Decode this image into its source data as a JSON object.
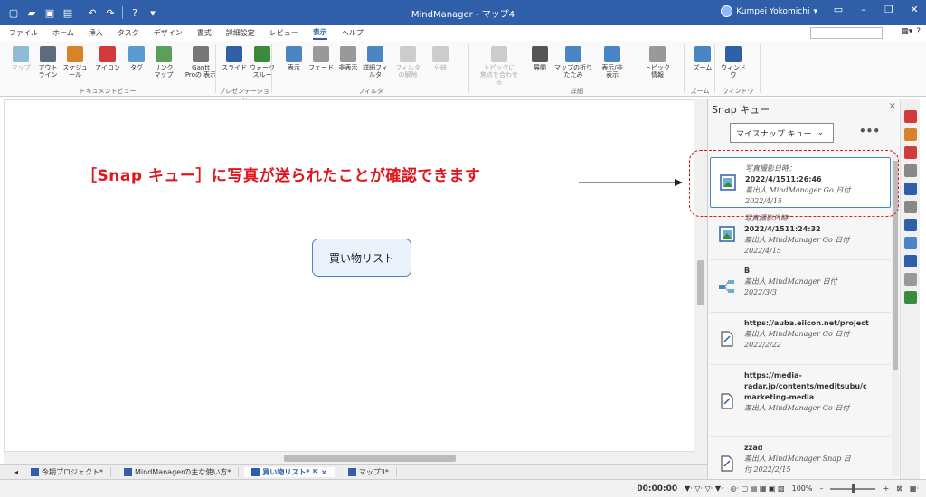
{
  "window": {
    "title": "MindManager - マップ4",
    "user": "Kumpei Yokomichi"
  },
  "tabs": [
    "ファイル",
    "ホーム",
    "挿入",
    "タスク",
    "デザイン",
    "書式",
    "詳細設定",
    "レビュー",
    "表示",
    "ヘルプ"
  ],
  "active_tab_index": 8,
  "ribbon": {
    "buttons": [
      {
        "label": "マップ",
        "color": "#8fbbd9"
      },
      {
        "label": "アウト\nライン",
        "color": "#5a6d7e"
      },
      {
        "label": "スケジュール",
        "color": "#d9822b"
      },
      {
        "label": "アイコン",
        "color": "#d23b3b"
      },
      {
        "label": "タグ",
        "color": "#5a9bd4"
      },
      {
        "label": "リンク\nマップ",
        "color": "#5aa05a"
      },
      {
        "label": "Gantt\nProの 表示",
        "color": "#777777"
      },
      {
        "label": "スライド",
        "color": "#2f5fa8"
      },
      {
        "label": "ウォーク\nスルー",
        "color": "#3c8a3c"
      },
      {
        "label": "表示",
        "color": "#4a86c5"
      },
      {
        "label": "フェード",
        "color": "#999999"
      },
      {
        "label": "非表示",
        "color": "#999999"
      },
      {
        "label": "詳細フィルタ",
        "color": "#4a86c5"
      },
      {
        "label": "フィルタの解除",
        "color": "#cccccc"
      },
      {
        "label": "分岐",
        "color": "#cccccc"
      },
      {
        "label": "トピックに\n焦点を合わせる",
        "color": "#cccccc"
      },
      {
        "label": "展開",
        "color": "#555555"
      },
      {
        "label": "マップの折りたたみ",
        "color": "#4a86c5"
      },
      {
        "label": "表示/非表示",
        "color": "#4a86c5"
      },
      {
        "label": "トピック情報",
        "color": "#999999"
      },
      {
        "label": "ズーム",
        "color": "#4a86c5"
      },
      {
        "label": "ウィンドウ",
        "color": "#2f5fa8"
      }
    ],
    "groups": [
      "ドキュメントビュー",
      "プレゼンテーション",
      "フィルタ",
      "詳細",
      "ズーム",
      "ウィンドウ"
    ]
  },
  "canvas": {
    "topic": "買い物リスト",
    "annotation": "［Snap キュー］に写真が送られたことが確認できます"
  },
  "snap_pane": {
    "title": "Snap キュー",
    "dropdown": "マイスナップ キュー",
    "more": "•••",
    "items": [
      {
        "icon": "image",
        "lines": [
          "写真撮影日時：",
          "2022/4/1511:26:46"
        ],
        "meta": "差出人 MindManager Go 日付",
        "date": "2022/4/15",
        "selected": true
      },
      {
        "icon": "image",
        "lines": [
          "写真撮影日時：",
          "2022/4/1511:24:32"
        ],
        "meta": "差出人 MindManager Go 日付",
        "date": "2022/4/15",
        "selected": false
      },
      {
        "icon": "map",
        "lines": [
          "B"
        ],
        "meta": "差出人 MindManager 日付",
        "date": "2022/3/3",
        "selected": false
      },
      {
        "icon": "doc",
        "lines": [
          "https://auba.eiicon.net/project"
        ],
        "meta": "差出人 MindManager Go 日付",
        "date": "2022/2/22",
        "selected": false
      },
      {
        "icon": "doc",
        "lines": [
          "https://media-",
          "radar.jp/contents/meditsubu/c",
          "marketing-media"
        ],
        "meta": "差出人 MindManager Go 日付",
        "date": "",
        "selected": false
      },
      {
        "icon": "doc",
        "lines": [
          "zzad"
        ],
        "meta": "差出人 MindManager Snap 日",
        "date": "付 2022/2/15",
        "selected": false
      }
    ]
  },
  "doc_tabs": [
    "今期プロジェクト*",
    "MindManagerの主な使い方*",
    "買い物リスト*",
    "マップ3*"
  ],
  "active_doc_tab": 2,
  "status": {
    "time": "00:00:00",
    "zoom": "100%"
  },
  "colors": {
    "accent": "#2f5fa8",
    "annotation": "#e0151d",
    "selection": "#4a86c5"
  }
}
